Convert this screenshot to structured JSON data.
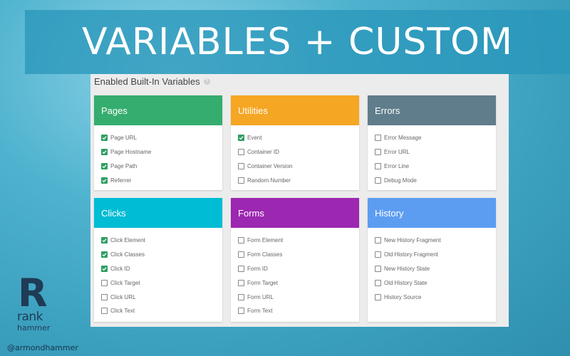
{
  "banner": {
    "title": "VARIABLES + CUSTOM"
  },
  "panel": {
    "title": "Enabled Built-In Variables",
    "help_icon": "?"
  },
  "cards": [
    {
      "title": "Pages",
      "color": "#35ad6e",
      "items": [
        {
          "label": "Page URL",
          "checked": true
        },
        {
          "label": "Page Hostname",
          "checked": true
        },
        {
          "label": "Page Path",
          "checked": true
        },
        {
          "label": "Referrer",
          "checked": true
        }
      ]
    },
    {
      "title": "Utilities",
      "color": "#f5a623",
      "items": [
        {
          "label": "Event",
          "checked": true
        },
        {
          "label": "Container ID",
          "checked": false
        },
        {
          "label": "Container Version",
          "checked": false
        },
        {
          "label": "Random Number",
          "checked": false
        }
      ]
    },
    {
      "title": "Errors",
      "color": "#607d8b",
      "items": [
        {
          "label": "Error Message",
          "checked": false
        },
        {
          "label": "Error URL",
          "checked": false
        },
        {
          "label": "Error Line",
          "checked": false
        },
        {
          "label": "Debug Mode",
          "checked": false
        }
      ]
    },
    {
      "title": "Clicks",
      "color": "#00bcd4",
      "items": [
        {
          "label": "Click Element",
          "checked": true
        },
        {
          "label": "Click Classes",
          "checked": true
        },
        {
          "label": "Click ID",
          "checked": true
        },
        {
          "label": "Click Target",
          "checked": false
        },
        {
          "label": "Click URL",
          "checked": false
        },
        {
          "label": "Click Text",
          "checked": false
        }
      ]
    },
    {
      "title": "Forms",
      "color": "#9c27b0",
      "items": [
        {
          "label": "Form Element",
          "checked": false
        },
        {
          "label": "Form Classes",
          "checked": false
        },
        {
          "label": "Form ID",
          "checked": false
        },
        {
          "label": "Form Target",
          "checked": false
        },
        {
          "label": "Form URL",
          "checked": false
        },
        {
          "label": "Form Text",
          "checked": false
        }
      ]
    },
    {
      "title": "History",
      "color": "#5c9df2",
      "items": [
        {
          "label": "New History Fragment",
          "checked": false
        },
        {
          "label": "Old History Fragment",
          "checked": false
        },
        {
          "label": "New History State",
          "checked": false
        },
        {
          "label": "Old History State",
          "checked": false
        },
        {
          "label": "History Source",
          "checked": false
        }
      ]
    }
  ],
  "logo": {
    "letter": "R",
    "word1": "rank",
    "word2": "hammer"
  },
  "handle": "@armondhammer"
}
